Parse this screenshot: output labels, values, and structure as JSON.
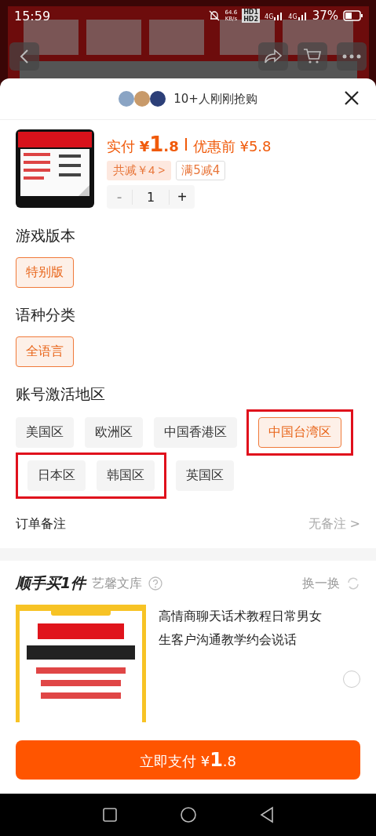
{
  "status_bar": {
    "time": "15:59",
    "speed": "64.6",
    "speed_unit": "KB/s",
    "hd_top": "HD1",
    "hd_bottom": "HD2",
    "net_1": "4G",
    "net_2": "4G",
    "battery": "37%"
  },
  "sheet": {
    "buyers_text": "10+人刚刚抢购",
    "product": {
      "paid_label": "实付",
      "currency": "¥",
      "price_int": "1",
      "price_dec": ".8",
      "original_label": "优惠前",
      "original_price": "¥5.8",
      "discount_tag": "共减￥4 >",
      "coupon_tag": "满5减4",
      "quantity": "1",
      "minus": "-",
      "plus": "+",
      "minus_disabled": true
    },
    "sections": [
      {
        "title": "游戏版本",
        "groups": [
          {
            "marked": false,
            "options": [
              {
                "label": "特别版",
                "selected": true
              }
            ]
          }
        ]
      },
      {
        "title": "语种分类",
        "groups": [
          {
            "marked": false,
            "options": [
              {
                "label": "全语言",
                "selected": true
              }
            ]
          }
        ]
      },
      {
        "title": "账号激活地区",
        "groups": [
          {
            "marked": false,
            "options": [
              {
                "label": "美国区",
                "selected": false
              },
              {
                "label": "欧洲区",
                "selected": false
              },
              {
                "label": "中国香港区",
                "selected": false
              }
            ]
          },
          {
            "marked": true,
            "options": [
              {
                "label": "中国台湾区",
                "selected": true
              }
            ]
          },
          {
            "marked": true,
            "options": [
              {
                "label": "日本区",
                "selected": false
              },
              {
                "label": "韩国区",
                "selected": false
              }
            ]
          },
          {
            "marked": false,
            "options": [
              {
                "label": "英国区",
                "selected": false
              }
            ]
          }
        ]
      }
    ],
    "note": {
      "label": "订单备注",
      "value": "无备注 >"
    },
    "addon": {
      "title": "顺手买1件",
      "shop": "艺馨文库",
      "refresh": "换一换",
      "item_title": "高情商聊天话术教程日常男女生客户沟通教学约会说话",
      "selected": false
    },
    "pay_button": "立即支付",
    "pay_currency": "¥",
    "pay_int": "1",
    "pay_dec": ".8"
  }
}
